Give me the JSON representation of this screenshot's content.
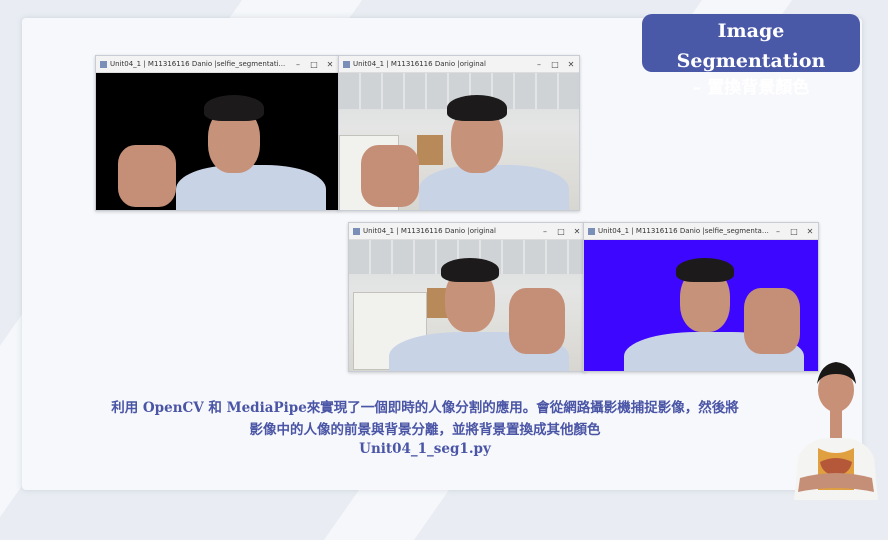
{
  "slide": {
    "title_line1": "Image Segmentation",
    "title_line2": "– 置換背景顏色",
    "caption_line1": "利用 OpenCV 和 MediaPipe來實現了一個即時的人像分割的應用。會從網路攝影機捕捉影像，然後將",
    "caption_line2": "影像中的人像的前景與背景分離，並將背景置換成其他顏色",
    "filename": "Unit04_1_seg1.py"
  },
  "windows": [
    {
      "title": "Unit04_1 | M11316116 Danio |selfie_segmentati...",
      "background": "black"
    },
    {
      "title": "Unit04_1 | M11316116 Danio |original",
      "background": "office"
    },
    {
      "title": "Unit04_1 | M11316116 Danio |original",
      "background": "office"
    },
    {
      "title": "Unit04_1 | M11316116 Danio |selfie_segmentati...",
      "background": "blue"
    }
  ],
  "window_controls": {
    "minimize": "–",
    "maximize": "□",
    "close": "✕"
  },
  "colors": {
    "accent": "#4a58a8",
    "caption": "#4a55a6",
    "seg_blue": "#3d06ff"
  }
}
